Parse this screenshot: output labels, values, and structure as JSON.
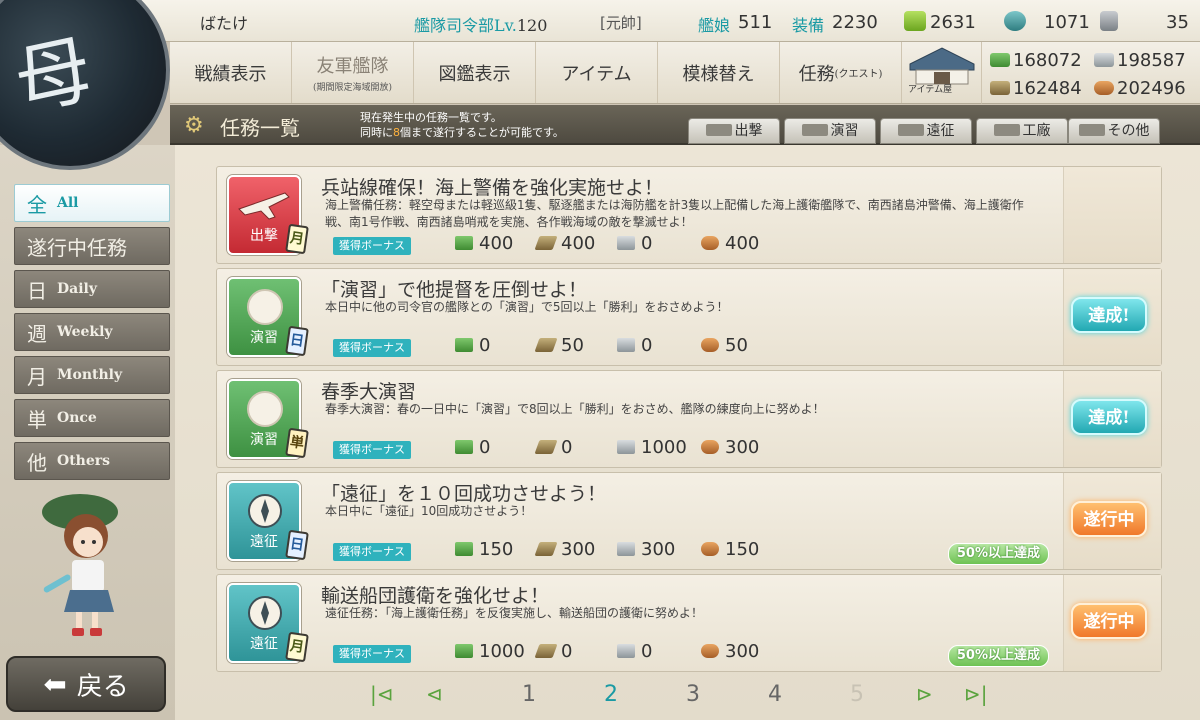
{
  "topbar": {
    "player_name": "ばたけ",
    "hq_label": "艦隊司令部Lv.",
    "hq_level": "120",
    "rank": "[元帥]",
    "ships_label": "艦娘",
    "ships_count": "511",
    "equip_label": "装備",
    "equip_count": "2230",
    "buckets": "2631",
    "dev_materials": "1071",
    "screws": "35"
  },
  "nav": {
    "items": [
      {
        "label": "戦績表示"
      },
      {
        "label": "友軍艦隊",
        "sub": "(期間限定海域開放)"
      },
      {
        "label": "図鑑表示"
      },
      {
        "label": "アイテム"
      },
      {
        "label": "模様替え"
      },
      {
        "label": "任務",
        "sub": "(クエスト)"
      }
    ],
    "item_shop_label": "アイテム屋"
  },
  "resources": {
    "fuel": "168072",
    "steel": "198587",
    "ammo": "162484",
    "bauxite": "202496"
  },
  "header": {
    "title": "任務一覧",
    "desc_line1": "現在発生中の任務一覧です。",
    "desc_line2_prefix": "同時に",
    "desc_line2_num": "8",
    "desc_line2_suffix": "個まで遂行することが可能です。",
    "filters": [
      "出撃",
      "演習",
      "遠征",
      "工廠",
      "その他"
    ]
  },
  "sidebar": {
    "categories": [
      {
        "big": "全",
        "small": "All"
      },
      {
        "big": "遂行中任務",
        "small": ""
      },
      {
        "big": "日",
        "small": "Daily"
      },
      {
        "big": "週",
        "small": "Weekly"
      },
      {
        "big": "月",
        "small": "Monthly"
      },
      {
        "big": "単",
        "small": "Once"
      },
      {
        "big": "他",
        "small": "Others"
      }
    ],
    "back_label": "戻る"
  },
  "quests": [
    {
      "category": "出撃",
      "period": "月",
      "title": "兵站線確保！海上警備を強化実施せよ！",
      "desc": "海上警備任務：軽空母または軽巡級1隻、駆逐艦または海防艦を計3隻以上配備した海上護衛艦隊で、南西諸島沖警備、海上護衛作戦、南1号作戦、南西諸島哨戒を実施、各作戦海域の敵を撃滅せよ！",
      "bonus_label": "獲得ボーナス",
      "fuel": "400",
      "ammo": "400",
      "steel": "0",
      "bauxite": "400",
      "status": "",
      "progress": ""
    },
    {
      "category": "演習",
      "period": "日",
      "title": "「演習」で他提督を圧倒せよ！",
      "desc": "本日中に他の司令官の艦隊との「演習」で5回以上「勝利」をおさめよう！",
      "bonus_label": "獲得ボーナス",
      "fuel": "0",
      "ammo": "50",
      "steel": "0",
      "bauxite": "50",
      "status": "達成!",
      "progress": ""
    },
    {
      "category": "演習",
      "period": "単",
      "title": "春季大演習",
      "desc": "春季大演習：春の一日中に「演習」で8回以上「勝利」をおさめ、艦隊の練度向上に努めよ！",
      "bonus_label": "獲得ボーナス",
      "fuel": "0",
      "ammo": "0",
      "steel": "1000",
      "bauxite": "300",
      "status": "達成!",
      "progress": ""
    },
    {
      "category": "遠征",
      "period": "日",
      "title": "「遠征」を１０回成功させよう！",
      "desc": "本日中に「遠征」10回成功させよう！",
      "bonus_label": "獲得ボーナス",
      "fuel": "150",
      "ammo": "300",
      "steel": "300",
      "bauxite": "150",
      "status": "遂行中",
      "progress": "50%以上達成"
    },
    {
      "category": "遠征",
      "period": "月",
      "title": "輸送船団護衛を強化せよ！",
      "desc": "遠征任務：「海上護衛任務」を反復実施し、輸送船団の護衛に努めよ！",
      "bonus_label": "獲得ボーナス",
      "fuel": "1000",
      "ammo": "0",
      "steel": "0",
      "bauxite": "300",
      "status": "遂行中",
      "progress": "50%以上達成"
    }
  ],
  "pager": {
    "pages": [
      "1",
      "2",
      "3",
      "4",
      "5"
    ],
    "current": "2"
  },
  "colors": {
    "accent": "#1a9aa4",
    "done": "#22a8b2",
    "in_progress": "#f0782a",
    "sortie": "#c42a33",
    "exercise": "#3e9142",
    "expedition": "#2f9498"
  }
}
